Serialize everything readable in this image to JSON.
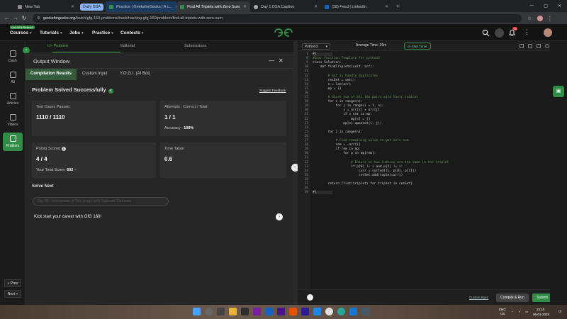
{
  "browser": {
    "tabs": [
      {
        "label": "New Tab"
      },
      {
        "label": "Practice | GeeksforGeeks | A c..."
      },
      {
        "label": "Find All Triplets with Zero Sum"
      },
      {
        "label": "Day 1 DSA Caption"
      },
      {
        "label": "(28) Feed | LinkedIn"
      }
    ],
    "group_label": "Daily DSA",
    "url_host": "geeksforgeeks.org",
    "url_path": "/batch/gfg-160-problems/track/hashing-gfg-160/problem/find-all-triplets-with-zero-sum"
  },
  "header": {
    "badge": "Get 90% Refund!",
    "nav": [
      {
        "label": "Courses"
      },
      {
        "label": "Tutorials"
      },
      {
        "label": "Jobs"
      },
      {
        "label": "Practice"
      },
      {
        "label": "Contests"
      }
    ],
    "notification_count": "10"
  },
  "leftnav": {
    "items": [
      {
        "label": "Dash"
      },
      {
        "label": "All"
      },
      {
        "label": "Articles"
      },
      {
        "label": "Videos"
      },
      {
        "label": "Problem"
      }
    ],
    "prev": "« Prev",
    "next": "Next »"
  },
  "problem_tabs": [
    {
      "label": "</> Problem"
    },
    {
      "label": "Editorial"
    },
    {
      "label": "Submissions"
    }
  ],
  "output": {
    "title": "Output Window",
    "minimize": "—",
    "close": "✕",
    "subtabs": [
      {
        "label": "Compilation Results"
      },
      {
        "label": "Custom Input"
      },
      {
        "label": "Y.O.G.I. (AI Bot)"
      }
    ],
    "status": "Problem Solved Successfully",
    "feedback": "Suggest Feedback",
    "cards": {
      "tests_label": "Test Cases Passed",
      "tests_value": "1110 / 1110",
      "attempts_label": "Attempts : Correct / Total",
      "attempts_value": "1 / 1",
      "accuracy_label": "Accuracy :",
      "accuracy_value": "100%",
      "points_label": "Points Scored",
      "points_value": "4 / 4",
      "total_label": "Your Total Score:",
      "total_value": "602",
      "time_label": "Time Taken",
      "time_value": "0.6"
    },
    "solve_next": "Solve Next",
    "next_problem": "Day 86 - Intersection of Two arrays with Duplicate Elements",
    "kick": "Kick start your career with GfG 160!"
  },
  "editor": {
    "language": "Python3",
    "avg_time": "Average Time: 25m",
    "timer": "Start Timer",
    "lines": [
      {
        "n": "1",
        "t": "#{ ",
        "cls": "cursor"
      },
      {
        "n": "8",
        "t": "#User function Template for python3",
        "cls": "comment"
      },
      {
        "n": "9",
        "t": "class Solution:",
        "cls": ""
      },
      {
        "n": "10",
        "t": "    def findTriplets(self, arr):",
        "cls": ""
      },
      {
        "n": "11",
        "t": "",
        "cls": ""
      },
      {
        "n": "12",
        "t": "        # Set to handle duplicates",
        "cls": "comment"
      },
      {
        "n": "13",
        "t": "        resSet = set()",
        "cls": ""
      },
      {
        "n": "14",
        "t": "        n = len(arr)",
        "cls": ""
      },
      {
        "n": "15",
        "t": "        mp = {}",
        "cls": ""
      },
      {
        "n": "16",
        "t": "",
        "cls": ""
      },
      {
        "n": "17",
        "t": "        # Store sum of all the pairs with their indices",
        "cls": "comment"
      },
      {
        "n": "18",
        "t": "        for i in range(n):",
        "cls": ""
      },
      {
        "n": "19",
        "t": "            for j in range(i + 1, n):",
        "cls": ""
      },
      {
        "n": "20",
        "t": "                s = arr[i] + arr[j]",
        "cls": ""
      },
      {
        "n": "21",
        "t": "                if s not in mp:",
        "cls": ""
      },
      {
        "n": "22",
        "t": "                    mp[s] = []",
        "cls": ""
      },
      {
        "n": "23",
        "t": "                mp[s].append((i, j))",
        "cls": ""
      },
      {
        "n": "24",
        "t": "",
        "cls": ""
      },
      {
        "n": "25",
        "t": "        for i in range(n):",
        "cls": ""
      },
      {
        "n": "26",
        "t": "",
        "cls": ""
      },
      {
        "n": "27",
        "t": "            # Find remaining value to get zero sum",
        "cls": "comment"
      },
      {
        "n": "28",
        "t": "            rem = -arr[i]",
        "cls": ""
      },
      {
        "n": "29",
        "t": "            if rem in mp:",
        "cls": ""
      },
      {
        "n": "30",
        "t": "                for p in mp[rem]:",
        "cls": ""
      },
      {
        "n": "31",
        "t": "",
        "cls": ""
      },
      {
        "n": "32",
        "t": "                    # Ensure no two indices are the same in the triplet",
        "cls": "comment"
      },
      {
        "n": "33",
        "t": "                    if p[0] != i and p[1] != i:",
        "cls": ""
      },
      {
        "n": "34",
        "t": "                        curr = sorted([i, p[0], p[1]])",
        "cls": ""
      },
      {
        "n": "35",
        "t": "                        resSet.add(tuple(curr))",
        "cls": ""
      },
      {
        "n": "36",
        "t": "",
        "cls": ""
      },
      {
        "n": "37",
        "t": "        return [list(triplet) for triplet in resSet]",
        "cls": ""
      },
      {
        "n": "38",
        "t": "",
        "cls": ""
      },
      {
        "n": "39",
        "t": "#{ ",
        "cls": "cursor"
      }
    ],
    "custom_input": "Custom Input",
    "compile": "Compile & Run",
    "submit": "Submit"
  },
  "taskbar": {
    "lang_top": "ENG",
    "lang_bottom": "US",
    "time": "23:15",
    "date": "06-01-2025"
  },
  "colors": {
    "accent": "#2f8d46",
    "bg": "#262626"
  }
}
